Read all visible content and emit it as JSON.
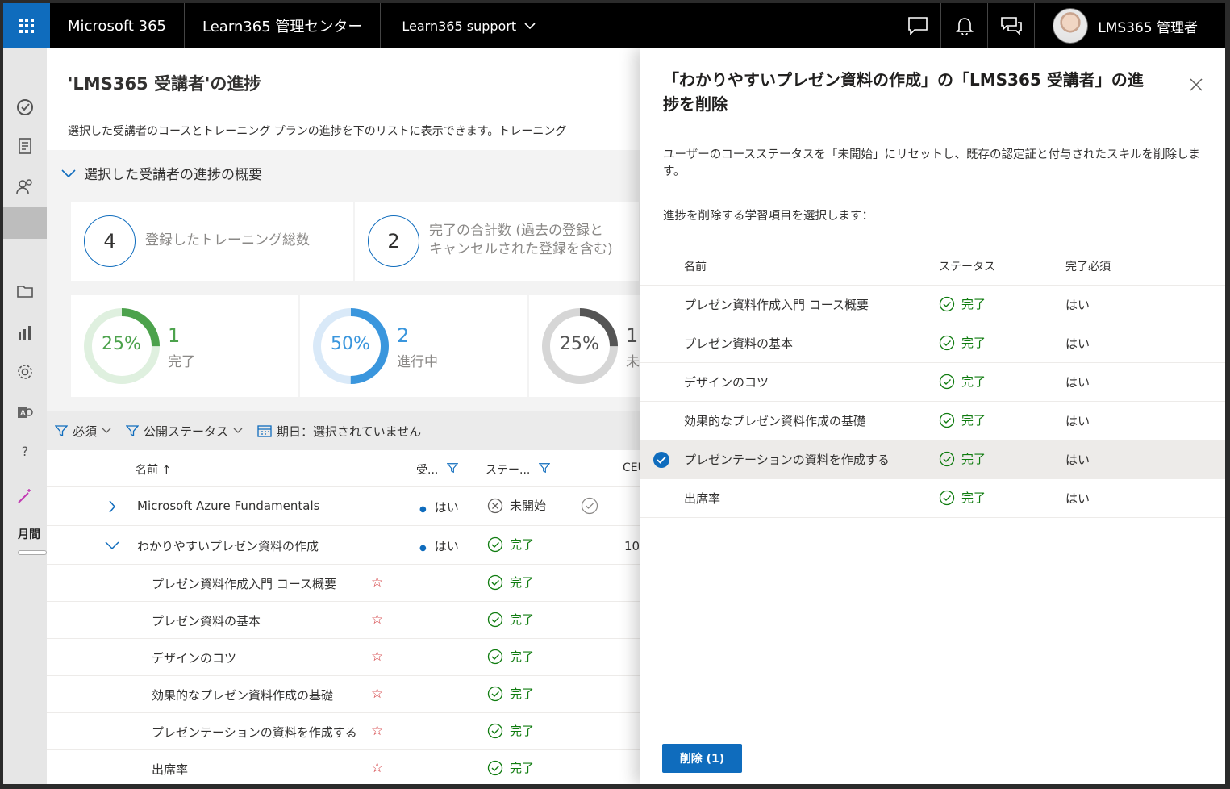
{
  "topbar": {
    "brand": "Microsoft 365",
    "org": "Learn365 管理センター",
    "tenant": "Learn365 support",
    "user": "LMS365 管理者"
  },
  "leftnav": {
    "text": "月間"
  },
  "main": {
    "title": "'LMS365 受講者'の進捗",
    "description": "選択した受講者のコースとトレーニング プランの進捗を下のリストに表示できます。トレーニング",
    "summary_header": "選択した受講者の進捗の概要",
    "stat_cards": [
      {
        "value": "4",
        "label": "登録したトレーニング総数"
      },
      {
        "value": "2",
        "label_line1": "完了の合計数 (過去の登録と",
        "label_line2": "キャンセルされた登録を含む)"
      }
    ],
    "donuts": [
      {
        "percent": "25%",
        "count": "1",
        "label": "完了",
        "fraction": 0.25,
        "color": "#4ca24c",
        "track": "#dff0df",
        "text_color": "#4ca24c"
      },
      {
        "percent": "50%",
        "count": "2",
        "label": "進行中",
        "fraction": 0.5,
        "color": "#3a96dd",
        "track": "#d9e9f8",
        "text_color": "#3a96dd"
      },
      {
        "percent": "25%",
        "count": "1",
        "label": "未",
        "fraction": 0.25,
        "color": "#555555",
        "track": "#d6d6d6",
        "text_color": "#555555"
      }
    ],
    "filters": {
      "required": "必須",
      "publish_status": "公開ステータス",
      "date": "期日：選択されていません"
    },
    "grid_headers": {
      "name": "名前 ↑",
      "required": "受...",
      "status": "ステー...",
      "ceu": "CEU"
    },
    "courses": [
      {
        "name": "Microsoft Azure Fundamentals",
        "required": "はい",
        "status": "未開始",
        "expanded": false
      },
      {
        "name": "わかりやすいプレゼン資料の作成",
        "required": "はい",
        "status": "完了",
        "ceu": "10",
        "expanded": true
      }
    ],
    "modules": [
      {
        "name": "プレゼン資料作成入門 コース概要",
        "status": "完了"
      },
      {
        "name": "プレゼン資料の基本",
        "status": "完了"
      },
      {
        "name": "デザインのコツ",
        "status": "完了"
      },
      {
        "name": "効果的なプレゼン資料作成の基礎",
        "status": "完了"
      },
      {
        "name": "プレゼンテーションの資料を作成する",
        "status": "完了"
      },
      {
        "name": "出席率",
        "status": "完了"
      }
    ]
  },
  "panel": {
    "title": "「わかりやすいプレゼン資料の作成」の「LMS365 受講者」の進捗を削除",
    "description": "ユーザーのコースステータスを「未開始」にリセットし、既存の認定証と付与されたスキルを削除します。",
    "prompt": "進捗を削除する学習項目を選択します：",
    "headers": {
      "name": "名前",
      "status": "ステータス",
      "required": "完了必須"
    },
    "rows": [
      {
        "name": "プレゼン資料作成入門 コース概要",
        "status": "完了",
        "required": "はい",
        "selected": false
      },
      {
        "name": "プレゼン資料の基本",
        "status": "完了",
        "required": "はい",
        "selected": false
      },
      {
        "name": "デザインのコツ",
        "status": "完了",
        "required": "はい",
        "selected": false
      },
      {
        "name": "効果的なプレゼン資料作成の基礎",
        "status": "完了",
        "required": "はい",
        "selected": false
      },
      {
        "name": "プレゼンテーションの資料を作成する",
        "status": "完了",
        "required": "はい",
        "selected": true
      },
      {
        "name": "出席率",
        "status": "完了",
        "required": "はい",
        "selected": false
      }
    ],
    "delete_button": "削除 (1)"
  },
  "colors": {
    "accent": "#0f6cbd",
    "success": "#107c10",
    "required_star": "#d13438"
  }
}
